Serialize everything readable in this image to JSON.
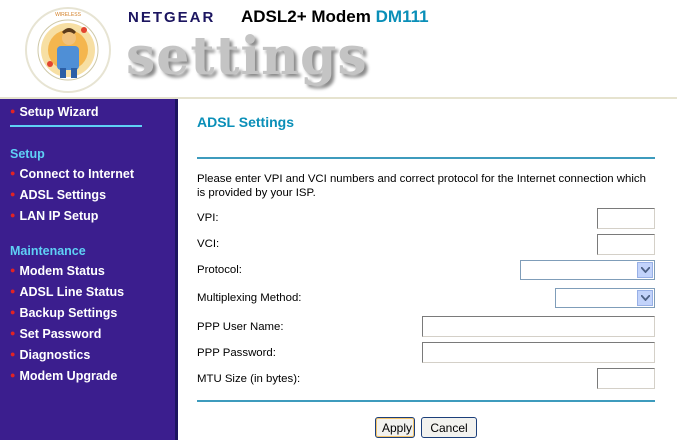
{
  "header": {
    "brand": "NETGEAR",
    "model_prefix": "ADSL2+ Modem",
    "model_id": "DM111",
    "banner_word": "settings",
    "logo_ring_text": "SWITCHES | WIRELESS | ROUTERS | ADAPTERS | HUBS"
  },
  "sidebar": {
    "wizard": "Setup Wizard",
    "setup_heading": "Setup",
    "setup_items": [
      "Connect to Internet",
      "ADSL Settings",
      "LAN IP Setup"
    ],
    "maintenance_heading": "Maintenance",
    "maintenance_items": [
      "Modem Status",
      "ADSL Line Status",
      "Backup Settings",
      "Set Password",
      "Diagnostics",
      "Modem Upgrade"
    ]
  },
  "main": {
    "title": "ADSL Settings",
    "intro": "Please enter VPI and VCI numbers and correct protocol for the Internet connection which is provided by your ISP.",
    "fields": {
      "vpi_label": "VPI:",
      "vpi_value": "",
      "vci_label": "VCI:",
      "vci_value": "",
      "protocol_label": "Protocol:",
      "protocol_value": "",
      "multiplexing_label": "Multiplexing Method:",
      "multiplexing_value": "",
      "ppp_user_label": "PPP User Name:",
      "ppp_user_value": "",
      "ppp_password_label": "PPP Password:",
      "ppp_password_value": "",
      "mtu_label": "MTU Size (in bytes):",
      "mtu_value": ""
    },
    "buttons": {
      "apply": "Apply",
      "cancel": "Cancel"
    }
  },
  "colors": {
    "sidebar_bg": "#3b1e8e",
    "sidebar_heading": "#5fd0f5",
    "bullet": "#e12323",
    "title": "#0a8fb8",
    "rule": "#3d9bbd",
    "brand": "#1c1560"
  }
}
